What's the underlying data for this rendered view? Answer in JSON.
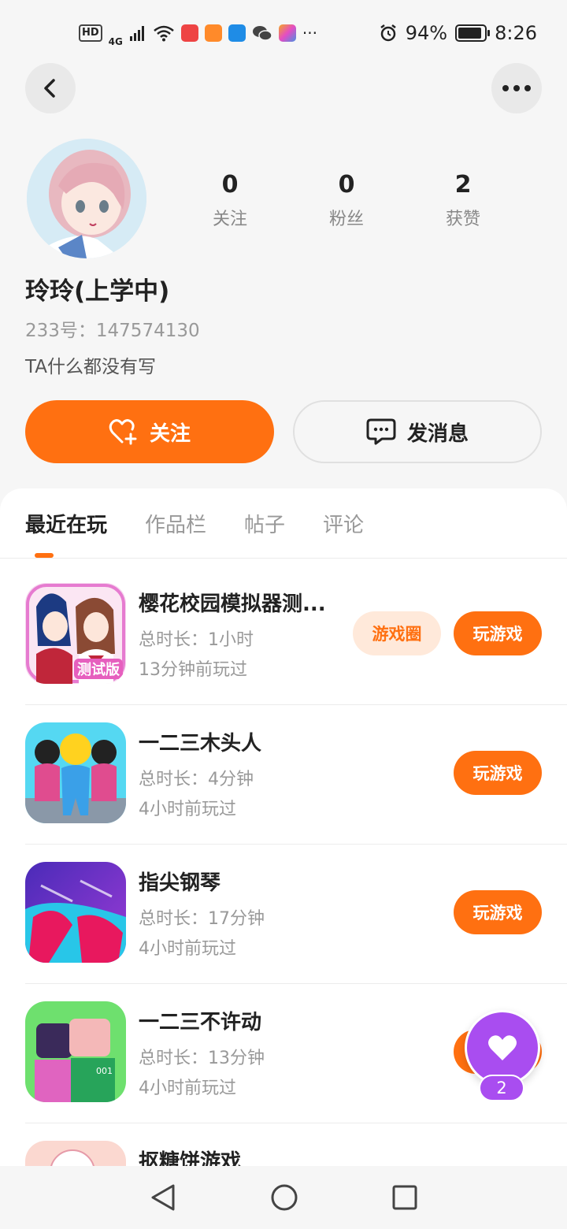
{
  "status_bar": {
    "network": "HD",
    "signal": "4G",
    "more": "···",
    "battery_text": "94%",
    "battery_level": 0.94,
    "time": "8:26",
    "app_icon_colors": [
      "#ee4444",
      "#ff8a2a",
      "#1f8ce6",
      "#444444",
      "#f5a623"
    ]
  },
  "header": {
    "back_icon": "back-arrow-icon",
    "more_icon": "more-dots-icon"
  },
  "profile": {
    "stats": [
      {
        "value": "0",
        "label": "关注"
      },
      {
        "value": "0",
        "label": "粉丝"
      },
      {
        "value": "2",
        "label": "获赞"
      }
    ],
    "name": "玲玲(上学中)",
    "uid_label": "233号：",
    "uid": "147574130",
    "bio": "TA什么都没有写",
    "follow_label": "关注",
    "message_label": "发消息"
  },
  "tabs": [
    {
      "label": "最近在玩",
      "active": true
    },
    {
      "label": "作品栏",
      "active": false
    },
    {
      "label": "帖子",
      "active": false
    },
    {
      "label": "评论",
      "active": false
    }
  ],
  "games": [
    {
      "name": "樱花校园模拟器测...",
      "duration": "总时长：1小时",
      "last_played": "13分钟前玩过",
      "circle_label": "游戏圈",
      "play_label": "玩游戏",
      "icon_badge": "测试版"
    },
    {
      "name": "一二三木头人",
      "duration": "总时长：4分钟",
      "last_played": "4小时前玩过",
      "play_label": "玩游戏"
    },
    {
      "name": "指尖钢琴",
      "duration": "总时长：17分钟",
      "last_played": "4小时前玩过",
      "play_label": "玩游戏"
    },
    {
      "name": "一二三不许动",
      "duration": "总时长：13分钟",
      "last_played": "4小时前玩过",
      "play_label": "玩游戏",
      "icon_badge": "001"
    },
    {
      "name": "抠糖饼游戏"
    }
  ],
  "floating_like": {
    "count": "2",
    "color": "#a94df0"
  },
  "colors": {
    "accent": "#ff7011",
    "accent_light": "#ffe9da",
    "background": "#f6f6f6"
  }
}
